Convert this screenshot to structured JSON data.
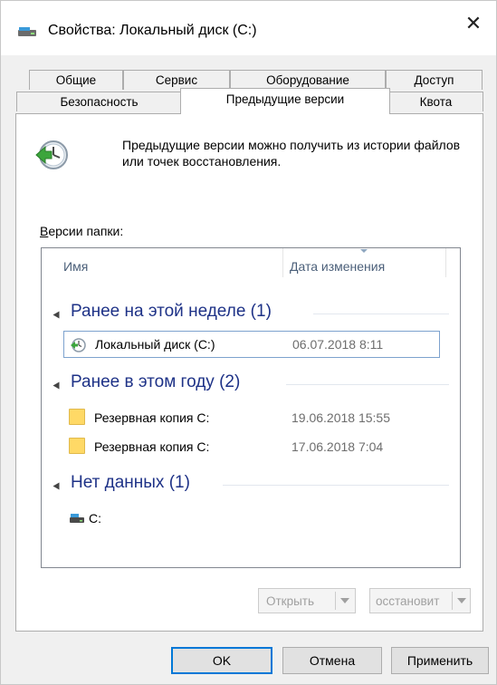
{
  "window": {
    "title": "Свойства: Локальный диск (C:)",
    "close_label": "✕"
  },
  "tabs": {
    "row1": [
      "Общие",
      "Сервис",
      "Оборудование",
      "Доступ"
    ],
    "row2": [
      "Безопасность",
      "Предыдущие версии",
      "Квота"
    ],
    "active": "Предыдущие версии"
  },
  "panel": {
    "info_text": "Предыдущие версии можно получить из истории файлов или точек восстановления.",
    "versions_label_prefix": "В",
    "versions_label_rest": "ерсии папки:"
  },
  "list": {
    "columns": [
      "Имя",
      "Дата изменения"
    ],
    "groups": [
      {
        "title": "Ранее на этой неделе (1)",
        "items": [
          {
            "name": "Локальный диск (C:)",
            "date": "06.07.2018 8:11",
            "icon": "restore-point-icon",
            "selected": true
          }
        ]
      },
      {
        "title": "Ранее в этом году (2)",
        "items": [
          {
            "name": "Резервная копия C:",
            "date": "19.06.2018 15:55",
            "icon": "folder-icon"
          },
          {
            "name": "Резервная копия C:",
            "date": "17.06.2018 7:04",
            "icon": "folder-icon"
          }
        ]
      },
      {
        "title": "Нет данных (1)",
        "items": [
          {
            "name": "C:",
            "date": "",
            "icon": "drive-icon"
          }
        ]
      }
    ]
  },
  "actions": {
    "open_label": "Открыть",
    "restore_label": "осстановит"
  },
  "footer": {
    "ok": "OK",
    "cancel": "Отмена",
    "apply": "Применить"
  },
  "colors": {
    "group_header": "#1e3287",
    "accent": "#0078d7",
    "selection_border": "#7da2ce"
  }
}
